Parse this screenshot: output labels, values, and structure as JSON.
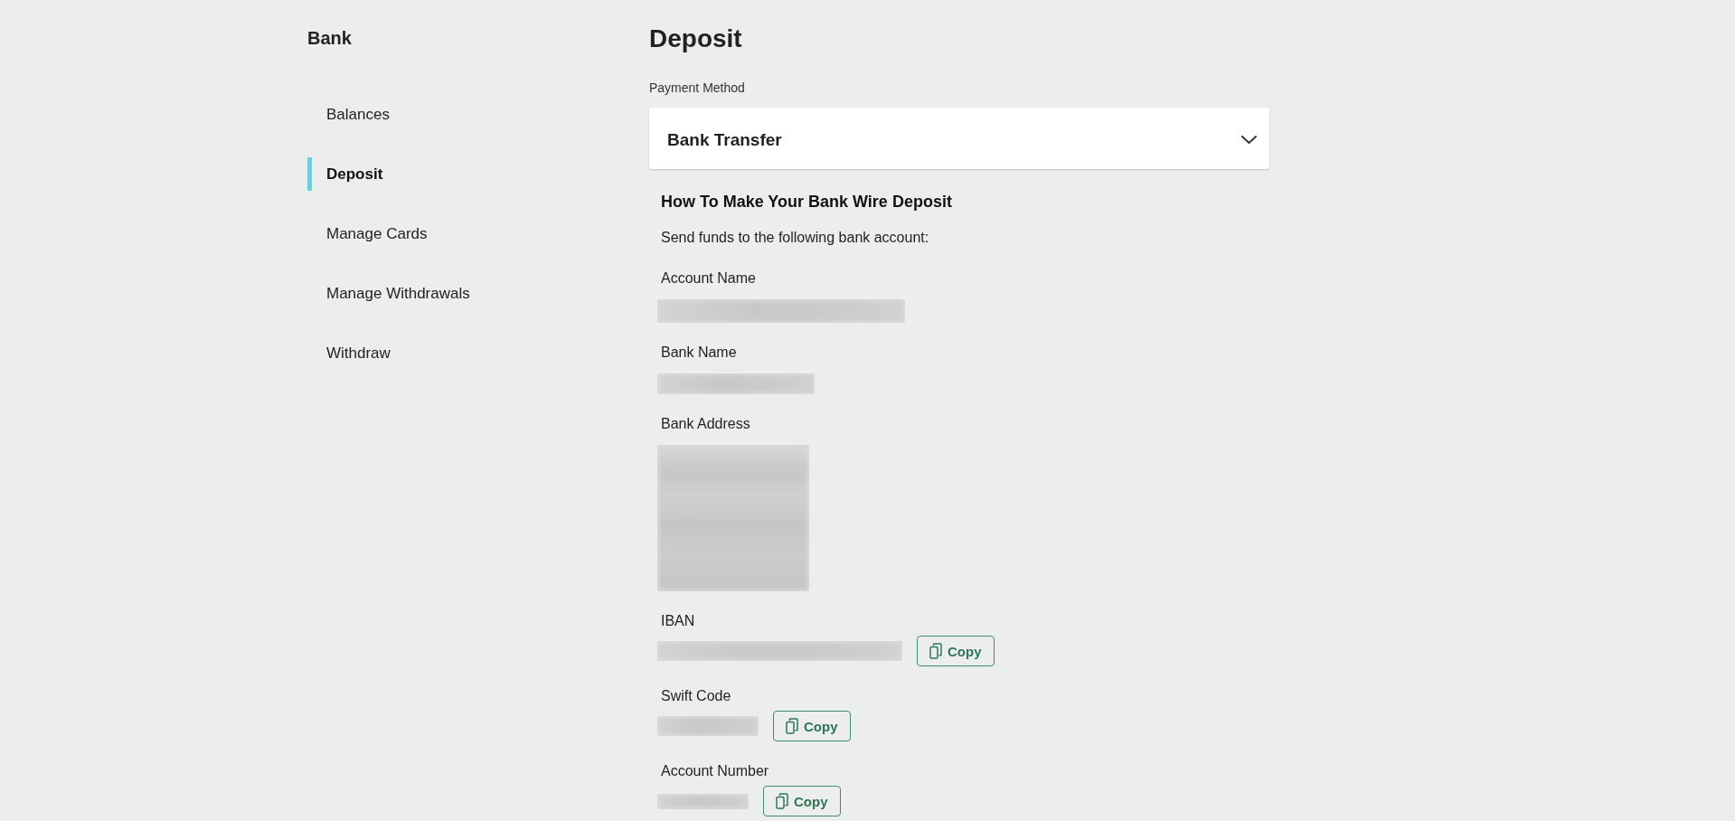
{
  "sidebar": {
    "title": "Bank",
    "items": [
      {
        "label": "Balances",
        "selected": false
      },
      {
        "label": "Deposit",
        "selected": true
      },
      {
        "label": "Manage Cards",
        "selected": false
      },
      {
        "label": "Manage Withdrawals",
        "selected": false
      },
      {
        "label": "Withdraw",
        "selected": false
      }
    ]
  },
  "main": {
    "title": "Deposit",
    "payment_method": {
      "label": "Payment Method",
      "value": "Bank Transfer"
    },
    "instructions": {
      "heading": "How To Make Your Bank Wire Deposit",
      "intro": "Send funds to the following bank account:",
      "fields": [
        {
          "label": "Account Name"
        },
        {
          "label": "Bank Name"
        },
        {
          "label": "Bank Address"
        },
        {
          "label": "IBAN",
          "copy_button": "Copy"
        },
        {
          "label": "Swift Code",
          "copy_button": "Copy"
        },
        {
          "label": "Account Number",
          "copy_button": "Copy"
        }
      ]
    }
  }
}
